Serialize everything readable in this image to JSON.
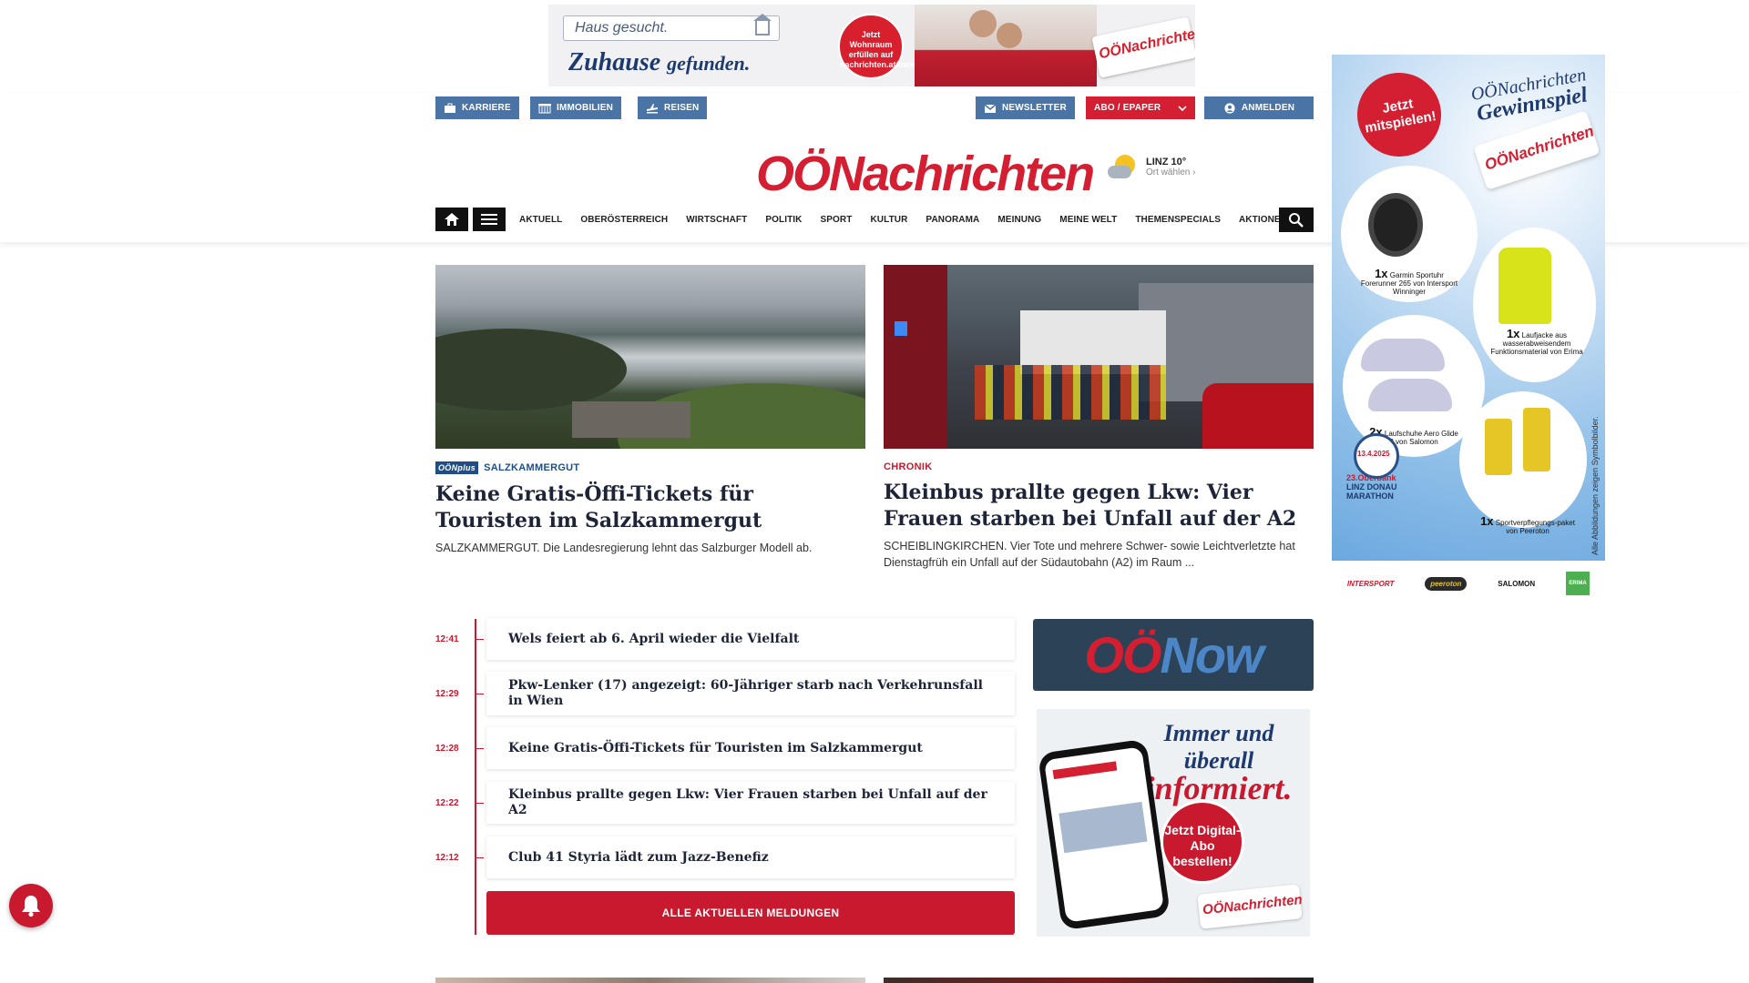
{
  "top_ad": {
    "search_text": "Haus gesucht.",
    "slogan_main": "Zuhause",
    "slogan_sub": "gefunden.",
    "badge": "Jetzt Wohnraum erfüllen auf nachrichten.at/immobilien",
    "brand": "OÖNachrichten"
  },
  "utility_nav": {
    "karriere": "KARRIERE",
    "immobilien": "IMMOBILIEN",
    "reisen": "REISEN",
    "newsletter": "NEWSLETTER",
    "abo": "ABO / EPAPER",
    "anmelden": "ANMELDEN"
  },
  "logo": "OÖNachrichten",
  "weather": {
    "city_temp": "LINZ 10°",
    "choose": "Ort wählen"
  },
  "main_nav": [
    "AKTUELL",
    "OBERÖSTERREICH",
    "WIRTSCHAFT",
    "POLITIK",
    "SPORT",
    "KULTUR",
    "PANORAMA",
    "MEINUNG",
    "MEINE WELT",
    "THEMENSPECIALS",
    "AKTIONEN"
  ],
  "stories": [
    {
      "badge": "OÖNplus",
      "kicker": "SALZKAMMERGUT",
      "title": "Keine Gratis-Öffi-Tickets für Touristen im Salzkammergut",
      "teaser": "SALZKAMMERGUT. Die Landesregierung lehnt das Salzburger Modell ab."
    },
    {
      "kicker": "CHRONIK",
      "title": "Kleinbus prallte gegen Lkw: Vier Frauen starben bei Unfall auf der A2",
      "teaser": "SCHEIBLINGKIRCHEN. Vier Tote und mehrere Schwer- sowie Leichtverletzte hat Dienstagfrüh ein Unfall auf der Südautobahn (A2) im Raum ..."
    }
  ],
  "timeline": [
    {
      "time": "12:41",
      "title": "Wels feiert ab 6. April wieder die Vielfalt"
    },
    {
      "time": "12:29",
      "title": "Pkw-Lenker (17) angezeigt: 60-Jähriger starb nach Verkehrunsfall in Wien"
    },
    {
      "time": "12:28",
      "title": "Keine Gratis-Öffi-Tickets für Touristen im Salzkammergut"
    },
    {
      "time": "12:22",
      "title": "Kleinbus prallte gegen Lkw: Vier Frauen starben bei Unfall auf der A2"
    },
    {
      "time": "12:12",
      "title": "Club 41 Styria lädt zum Jazz-Benefiz"
    }
  ],
  "all_news_button": "ALLE AKTUELLEN MELDUNGEN",
  "oenow": {
    "part1": "OÖ",
    "part2": "Now"
  },
  "abo_ad": {
    "headline1": "Immer und überall",
    "headline2": "informiert.",
    "cta": "Jetzt Digital-Abo bestellen!",
    "brand": "OÖNachrichten"
  },
  "side_ad": {
    "jetzt": "Jetzt mitspielen!",
    "title1": "OÖNachrichten",
    "title2": "Gewinnspiel",
    "brand": "OÖNachrichten",
    "prize1_count": "1x",
    "prize1": "Garmin Sportuhr Forerunner 265 von Intersport Winninger",
    "prize2_count": "1x",
    "prize2": "Laufjacke aus wasserabweisendem Funktionsmaterial von Erima",
    "prize3_count": "2x",
    "prize3": "Laufschuhe Aero Glide 3 von Salomon",
    "prize4_count": "1x",
    "prize4": "Sportverpflegungs-paket von Peeroton",
    "date": "13.4.2025",
    "marathon1": "23.Oberbank",
    "marathon2": "LINZ DONAU",
    "marathon3": "MARATHON",
    "disclaimer": "Alle Abbildungen zeigen Symbolbilder.",
    "sponsors": [
      "INTERSPORT",
      "peeroton",
      "SALOMON",
      "ERIMA"
    ]
  },
  "colors": {
    "brand_red": "#d41e31",
    "utility_blue": "#4a74a6",
    "navy_text": "#1d2438",
    "kicker_blue": "#1f4e86"
  }
}
